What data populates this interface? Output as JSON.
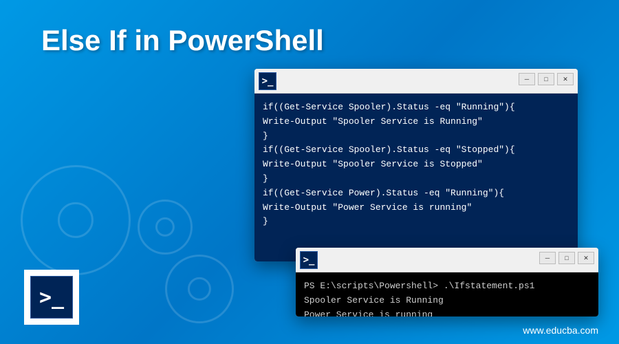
{
  "title": "Else If in PowerShell",
  "window1": {
    "lines": [
      "if((Get-Service Spooler).Status -eq \"Running\"){",
      "Write-Output \"Spooler Service is Running\"",
      "}",
      "if((Get-Service Spooler).Status -eq \"Stopped\"){",
      "Write-Output \"Spooler Service is Stopped\"",
      "}",
      "if((Get-Service Power).Status -eq \"Running\"){",
      "Write-Output \"Power Service is running\"",
      "}"
    ]
  },
  "window2": {
    "lines": [
      "PS E:\\scripts\\Powershell> .\\Ifstatement.ps1",
      "Spooler Service is Running",
      "Power Service is running"
    ]
  },
  "win_controls": {
    "min": "─",
    "max": "□",
    "close": "✕"
  },
  "ps_icon_text": ">_",
  "footer_url": "www.educba.com"
}
